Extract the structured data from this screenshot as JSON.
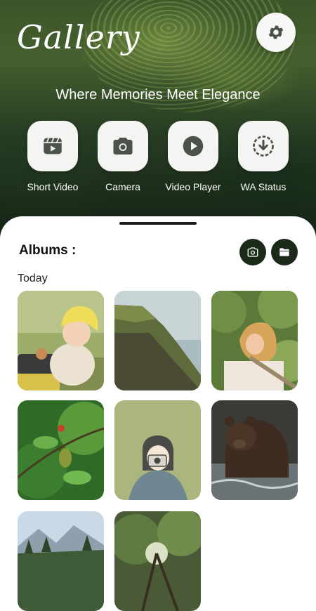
{
  "header": {
    "title": "Gallery",
    "tagline": "Where Memories Meet Elegance",
    "settings_icon": "gear-icon"
  },
  "features": [
    {
      "label": "Short Video",
      "icon": "short-video-icon"
    },
    {
      "label": "Camera",
      "icon": "camera-icon"
    },
    {
      "label": "Video Player",
      "icon": "play-icon"
    },
    {
      "label": "WA Status",
      "icon": "download-status-icon"
    }
  ],
  "albums": {
    "title": "Albums :",
    "camera_button_icon": "camera-icon",
    "folder_button_icon": "folder-icon",
    "section_label": "Today",
    "photos": [
      "child-in-yellow-hat",
      "sea-cliff",
      "woman-on-railing",
      "bird-on-branch",
      "girl-with-camera-illustration",
      "brown-bear-in-water",
      "mountain-landscape",
      "forest-canopy"
    ]
  },
  "colors": {
    "accent_dark": "#1c2a1a",
    "tile_background": "#f4f4f2",
    "icon_gray": "#4a524a"
  }
}
